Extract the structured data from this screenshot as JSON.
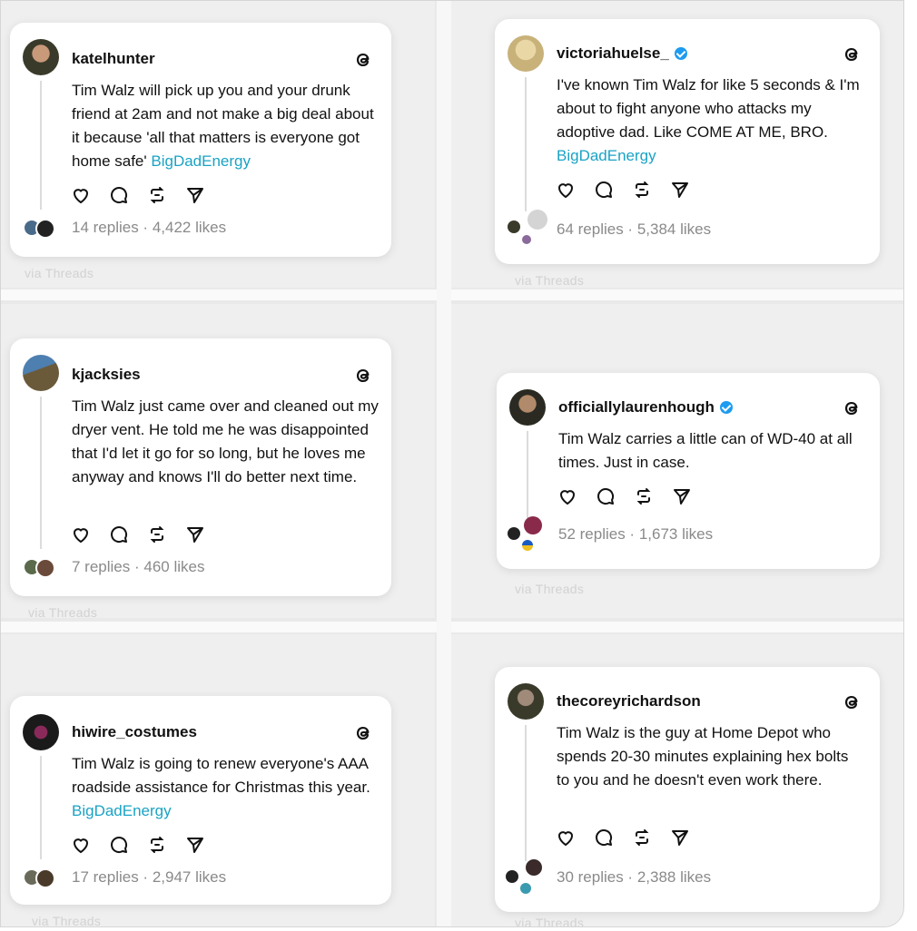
{
  "via_label": "via Threads",
  "tag_text": "BigDadEnergy",
  "colors": {
    "tag": "#1aa3c4",
    "verified": "#1d9bf0",
    "stats": "#8a8a8a"
  },
  "posts": [
    {
      "username": "katelhunter",
      "verified": false,
      "text": "Tim Walz will pick up you and your drunk friend at 2am and not make a big deal about it because 'all that matters is everyone got home safe'",
      "hashtag": "BigDadEnergy",
      "stats": "14 replies · 4,422 likes"
    },
    {
      "username": "victoriahuelse_",
      "verified": true,
      "text": "I've known Tim Walz for like 5 seconds & I'm about to fight anyone who attacks my adoptive dad. Like COME AT ME, BRO.",
      "hashtag": "BigDadEnergy",
      "stats": "64 replies · 5,384 likes"
    },
    {
      "username": "kjacksies",
      "verified": false,
      "text": "Tim Walz just came over and cleaned out my dryer vent. He told me he was disappointed that I'd let it go for so long, but he loves me anyway and knows I'll do better next time.",
      "hashtag": "",
      "stats": "7 replies · 460 likes"
    },
    {
      "username": "officiallylaurenhough",
      "verified": true,
      "text": "Tim Walz carries a little can of WD-40 at all times. Just in case.",
      "hashtag": "",
      "stats": "52 replies · 1,673 likes"
    },
    {
      "username": "hiwire_costumes",
      "verified": false,
      "text": "Tim Walz is going to renew everyone's AAA roadside assistance for Christmas this year.",
      "hashtag": "BigDadEnergy",
      "stats": "17 replies · 2,947 likes"
    },
    {
      "username": "thecoreyrichardson",
      "verified": false,
      "text": "Tim Walz is the guy at Home Depot who spends 20-30 minutes explaining hex bolts to you and he doesn't even work there.",
      "hashtag": "",
      "stats": "30 replies · 2,388 likes"
    }
  ]
}
